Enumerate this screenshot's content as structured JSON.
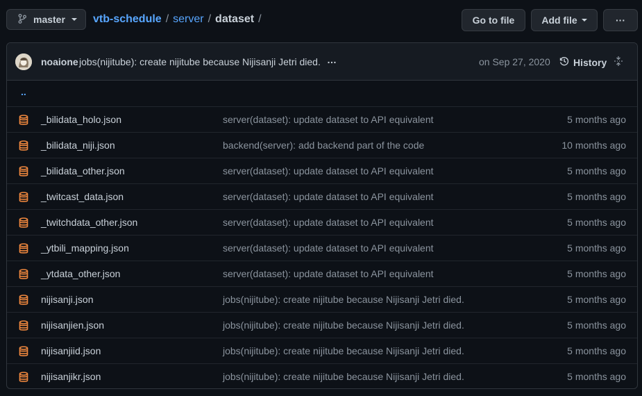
{
  "branch": {
    "name": "master"
  },
  "breadcrumb": {
    "repo": "vtb-schedule",
    "sep1": "/",
    "folder": "server",
    "sep2": "/",
    "current": "dataset",
    "sep3": "/"
  },
  "buttons": {
    "go_to_file": "Go to file",
    "add_file": "Add file",
    "more": "···"
  },
  "commit": {
    "author": "noaione",
    "message": "jobs(nijitube): create nijitube because Nijisanji Jetri died.",
    "ellipsis": "…",
    "date": "on Sep 27, 2020",
    "history_label": "History"
  },
  "parent_dir": "..",
  "colors": {
    "accent": "#58a6ff",
    "file_icon": "#f0883e",
    "bg": "#0d1117"
  },
  "files": [
    {
      "name": "_bilidata_holo.json",
      "message": "server(dataset): update dataset to API equivalent",
      "age": "5 months ago"
    },
    {
      "name": "_bilidata_niji.json",
      "message": "backend(server): add backend part of the code",
      "age": "10 months ago"
    },
    {
      "name": "_bilidata_other.json",
      "message": "server(dataset): update dataset to API equivalent",
      "age": "5 months ago"
    },
    {
      "name": "_twitcast_data.json",
      "message": "server(dataset): update dataset to API equivalent",
      "age": "5 months ago"
    },
    {
      "name": "_twitchdata_other.json",
      "message": "server(dataset): update dataset to API equivalent",
      "age": "5 months ago"
    },
    {
      "name": "_ytbili_mapping.json",
      "message": "server(dataset): update dataset to API equivalent",
      "age": "5 months ago"
    },
    {
      "name": "_ytdata_other.json",
      "message": "server(dataset): update dataset to API equivalent",
      "age": "5 months ago"
    },
    {
      "name": "nijisanji.json",
      "message": "jobs(nijitube): create nijitube because Nijisanji Jetri died.",
      "age": "5 months ago"
    },
    {
      "name": "nijisanjien.json",
      "message": "jobs(nijitube): create nijitube because Nijisanji Jetri died.",
      "age": "5 months ago"
    },
    {
      "name": "nijisanjiid.json",
      "message": "jobs(nijitube): create nijitube because Nijisanji Jetri died.",
      "age": "5 months ago"
    },
    {
      "name": "nijisanjikr.json",
      "message": "jobs(nijitube): create nijitube because Nijisanji Jetri died.",
      "age": "5 months ago"
    }
  ]
}
